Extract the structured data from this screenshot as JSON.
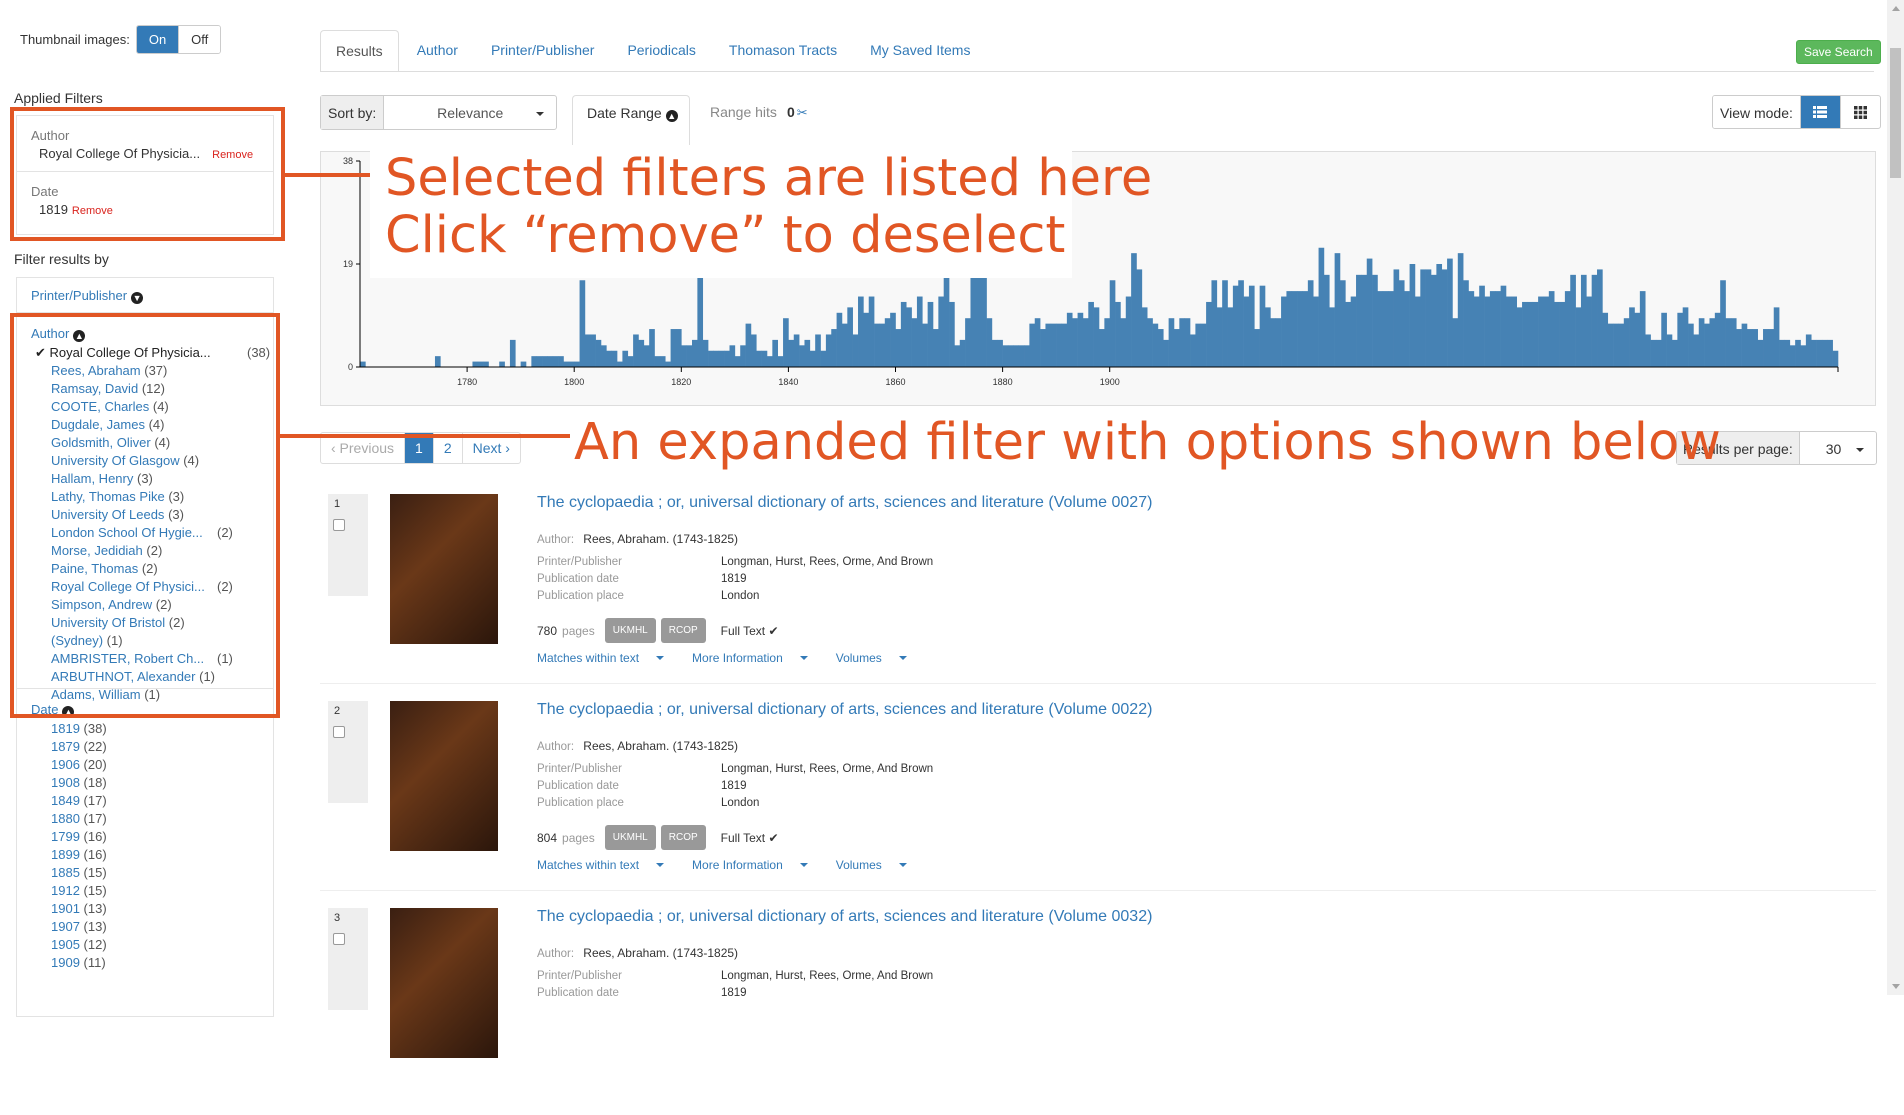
{
  "thumbnail": {
    "label": "Thumbnail images:",
    "on": "On",
    "off": "Off"
  },
  "applied": {
    "title": "Applied Filters",
    "filters": [
      {
        "type": "Author",
        "value": "Royal College Of Physicia...",
        "remove": "Remove"
      },
      {
        "type": "Date",
        "value": "1819",
        "remove": "Remove"
      }
    ]
  },
  "filter": {
    "title": "Filter results by",
    "printer_head": "Printer/Publisher",
    "author_head": "Author",
    "author_selected": {
      "name": "Royal College Of Physicia...",
      "count": "(38)"
    },
    "author_options": [
      {
        "name": "Rees, Abraham",
        "count": "(37)"
      },
      {
        "name": "Ramsay, David",
        "count": "(12)"
      },
      {
        "name": "COOTE, Charles",
        "count": "(4)"
      },
      {
        "name": "Dugdale, James",
        "count": "(4)"
      },
      {
        "name": "Goldsmith, Oliver",
        "count": "(4)"
      },
      {
        "name": "University Of Glasgow",
        "count": "(4)"
      },
      {
        "name": "Hallam, Henry",
        "count": "(3)"
      },
      {
        "name": "Lathy, Thomas Pike",
        "count": "(3)"
      },
      {
        "name": "University Of Leeds",
        "count": "(3)"
      },
      {
        "name": "London School Of Hygie...",
        "count": "(2)",
        "right": true
      },
      {
        "name": "Morse, Jedidiah",
        "count": "(2)"
      },
      {
        "name": "Paine, Thomas",
        "count": "(2)"
      },
      {
        "name": "Royal College Of Physici...",
        "count": "(2)",
        "right": true
      },
      {
        "name": "Simpson, Andrew",
        "count": "(2)"
      },
      {
        "name": "University Of Bristol",
        "count": "(2)"
      },
      {
        "name": "(Sydney)",
        "count": "(1)"
      },
      {
        "name": "AMBRISTER, Robert Ch...",
        "count": "(1)",
        "right": true
      },
      {
        "name": "ARBUTHNOT, Alexander",
        "count": "(1)"
      },
      {
        "name": "Adams, William",
        "count": "(1)"
      }
    ],
    "date_head": "Date",
    "date_options": [
      {
        "name": "1819",
        "count": "(38)"
      },
      {
        "name": "1879",
        "count": "(22)"
      },
      {
        "name": "1906",
        "count": "(20)"
      },
      {
        "name": "1908",
        "count": "(18)"
      },
      {
        "name": "1849",
        "count": "(17)"
      },
      {
        "name": "1880",
        "count": "(17)"
      },
      {
        "name": "1799",
        "count": "(16)"
      },
      {
        "name": "1899",
        "count": "(16)"
      },
      {
        "name": "1885",
        "count": "(15)"
      },
      {
        "name": "1912",
        "count": "(15)"
      },
      {
        "name": "1901",
        "count": "(13)"
      },
      {
        "name": "1907",
        "count": "(13)"
      },
      {
        "name": "1905",
        "count": "(12)"
      },
      {
        "name": "1909",
        "count": "(11)"
      }
    ]
  },
  "tabs": [
    "Results",
    "Author",
    "Printer/Publisher",
    "Periodicals",
    "Thomason Tracts",
    "My Saved Items"
  ],
  "save_search": "Save Search",
  "sort": {
    "label": "Sort by:",
    "value": "Relevance"
  },
  "date_range": "Date Range",
  "range_hits": {
    "label": "Range hits",
    "value": "0"
  },
  "view_mode": "View mode:",
  "annotations": {
    "line1": "Selected filters are listed here",
    "line2": "Click “remove” to deselect",
    "expanded": "An expanded filter with options shown below"
  },
  "pagination": {
    "prev": "‹ Previous",
    "p1": "1",
    "p2": "2",
    "next": "Next ›"
  },
  "results_per_page": {
    "label": "Results per page:",
    "value": "30"
  },
  "results": [
    {
      "num": "1",
      "title": "The cyclopaedia ; or, universal dictionary of arts, sciences and literature (Volume 0027)",
      "author_label": "Author:",
      "author": "Rees, Abraham. (1743-1825)",
      "printer_label": "Printer/Publisher",
      "printer": "Longman, Hurst, Rees, Orme, And Brown",
      "date_label": "Publication date",
      "date": "1819",
      "place_label": "Publication place",
      "place": "London",
      "pages": "780",
      "pages_label": "pages",
      "badge1": "UKMHL",
      "badge2": "RCOP",
      "fulltext": "Full Text ✔",
      "link1": "Matches within text",
      "link2": "More Information",
      "link3": "Volumes"
    },
    {
      "num": "2",
      "title": "The cyclopaedia ; or, universal dictionary of arts, sciences and literature (Volume 0022)",
      "author_label": "Author:",
      "author": "Rees, Abraham. (1743-1825)",
      "printer_label": "Printer/Publisher",
      "printer": "Longman, Hurst, Rees, Orme, And Brown",
      "date_label": "Publication date",
      "date": "1819",
      "place_label": "Publication place",
      "place": "London",
      "pages": "804",
      "pages_label": "pages",
      "badge1": "UKMHL",
      "badge2": "RCOP",
      "fulltext": "Full Text ✔",
      "link1": "Matches within text",
      "link2": "More Information",
      "link3": "Volumes"
    },
    {
      "num": "3",
      "title": "The cyclopaedia ; or, universal dictionary of arts, sciences and literature (Volume 0032)",
      "author_label": "Author:",
      "author": "Rees, Abraham. (1743-1825)",
      "printer_label": "Printer/Publisher",
      "printer": "Longman, Hurst, Rees, Orme, And Brown",
      "date_label": "Publication date",
      "date": "1819",
      "place_label": "",
      "place": "",
      "pages": "",
      "pages_label": "",
      "badge1": "",
      "badge2": "",
      "fulltext": "",
      "link1": "",
      "link2": "",
      "link3": ""
    }
  ],
  "chart_data": {
    "type": "bar",
    "color": "#4682b4",
    "ylim": [
      0,
      38
    ],
    "yticks": [
      "0",
      "19",
      "38"
    ],
    "xticks": [
      "1780",
      "1800",
      "1820",
      "1840",
      "1860",
      "1880",
      "1900"
    ],
    "x_start": 1760,
    "values": [
      1,
      0,
      0,
      0,
      0,
      0,
      0,
      0,
      0,
      0,
      0,
      0,
      0,
      0,
      2,
      0,
      0,
      0,
      0,
      0,
      0,
      1,
      1,
      1,
      0,
      0,
      1,
      0,
      5,
      0,
      1,
      0,
      2,
      2,
      2,
      2,
      2,
      2,
      1,
      1,
      1,
      16,
      6,
      6,
      5,
      4,
      3,
      3,
      1,
      3,
      2,
      6,
      5,
      4,
      7,
      2,
      2,
      1,
      7,
      7,
      4,
      4,
      5,
      22,
      5,
      3,
      3,
      3,
      3,
      4,
      2,
      4,
      8,
      6,
      3,
      3,
      2,
      5,
      2,
      9,
      5,
      6,
      4,
      5,
      3,
      6,
      3,
      6,
      7,
      10,
      8,
      11,
      6,
      13,
      10,
      13,
      8,
      8,
      9,
      10,
      7,
      12,
      11,
      9,
      13,
      8,
      12,
      7,
      13,
      22,
      12,
      4,
      5,
      9,
      17,
      17,
      17,
      9,
      5,
      5,
      4,
      4,
      4,
      4,
      4,
      8,
      9,
      7,
      8,
      8,
      8,
      8,
      10,
      9,
      10,
      9,
      12,
      11,
      7,
      9,
      16,
      12,
      9,
      13,
      21,
      18,
      11,
      9,
      8,
      7,
      5,
      9,
      7,
      9,
      9,
      6,
      8,
      8,
      12,
      16,
      11,
      16,
      11,
      15,
      16,
      13,
      15,
      7,
      15,
      11,
      9,
      9,
      13,
      14,
      14,
      14,
      14,
      16,
      13,
      22,
      17,
      11,
      21,
      16,
      12,
      13,
      17,
      17,
      20,
      17,
      14,
      14,
      14,
      18,
      16,
      14,
      19,
      13,
      18,
      18,
      17,
      19,
      18,
      20,
      9,
      21,
      16,
      14,
      13,
      15,
      13,
      14,
      14,
      15,
      13,
      13,
      11,
      12,
      12,
      12,
      13,
      13,
      14,
      12,
      12,
      14,
      17,
      11,
      17,
      13,
      17,
      18,
      10,
      8,
      8,
      8,
      9,
      11,
      10,
      14,
      6,
      5,
      5,
      10,
      6,
      5,
      10,
      11,
      8,
      6,
      9,
      8,
      9,
      10,
      16,
      9,
      9,
      7,
      8,
      7,
      7,
      5,
      7,
      7,
      11,
      5,
      5,
      4,
      5,
      4,
      6,
      5,
      5,
      5,
      5,
      3
    ]
  }
}
